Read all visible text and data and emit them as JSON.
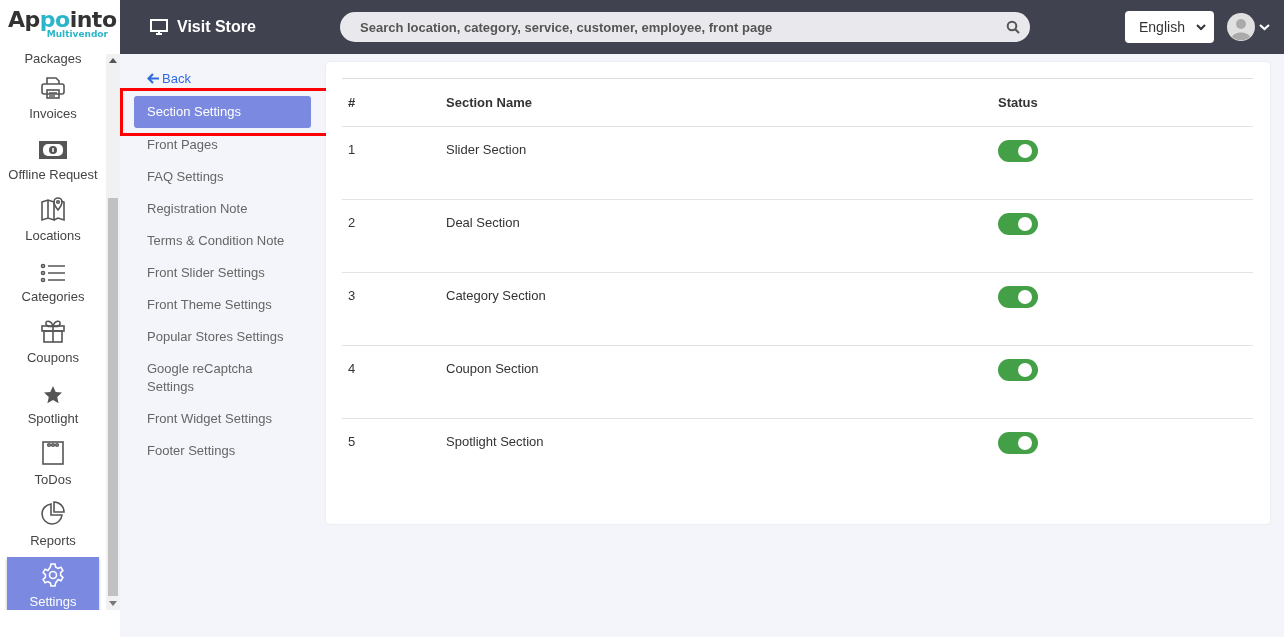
{
  "logo": {
    "parts": [
      {
        "text": "Ap",
        "kind": "plain"
      },
      {
        "text": "po",
        "kind": "accent"
      },
      {
        "text": "into",
        "kind": "plain"
      }
    ],
    "subtitle": "Multivendor"
  },
  "sidebar": {
    "items": [
      {
        "label": "Packages",
        "selected": false
      },
      {
        "label": "Invoices",
        "selected": false
      },
      {
        "label": "Offline Request",
        "selected": false
      },
      {
        "label": "Locations",
        "selected": false
      },
      {
        "label": "Categories",
        "selected": false
      },
      {
        "label": "Coupons",
        "selected": false
      },
      {
        "label": "Spotlight",
        "selected": false
      },
      {
        "label": "ToDos",
        "selected": false
      },
      {
        "label": "Reports",
        "selected": false
      },
      {
        "label": "Settings",
        "selected": true
      }
    ]
  },
  "topbar": {
    "visit_store": "Visit Store",
    "search": {
      "placeholder": "Search location, category, service, customer, employee, front page"
    },
    "language": "English"
  },
  "settings_menu": {
    "back": "Back",
    "items": [
      {
        "label": "Section Settings",
        "selected": true,
        "highlighted": true
      },
      {
        "label": "Front Pages",
        "selected": false,
        "highlighted": false
      },
      {
        "label": "FAQ Settings",
        "selected": false,
        "highlighted": false
      },
      {
        "label": "Registration Note",
        "selected": false,
        "highlighted": false
      },
      {
        "label": "Terms & Condition Note",
        "selected": false,
        "highlighted": false
      },
      {
        "label": "Front Slider Settings",
        "selected": false,
        "highlighted": false
      },
      {
        "label": "Front Theme Settings",
        "selected": false,
        "highlighted": false
      },
      {
        "label": "Popular Stores Settings",
        "selected": false,
        "highlighted": false
      },
      {
        "label": "Google reCaptcha Settings",
        "selected": false,
        "highlighted": false
      },
      {
        "label": "Front Widget Settings",
        "selected": false,
        "highlighted": false
      },
      {
        "label": "Footer Settings",
        "selected": false,
        "highlighted": false
      }
    ]
  },
  "table": {
    "columns": [
      "#",
      "Section Name",
      "Status"
    ],
    "rows": [
      {
        "number": "1",
        "name": "Slider Section",
        "on": true
      },
      {
        "number": "2",
        "name": "Deal Section",
        "on": true
      },
      {
        "number": "3",
        "name": "Category Section",
        "on": true
      },
      {
        "number": "4",
        "name": "Coupon Section",
        "on": true
      },
      {
        "number": "5",
        "name": "Spotlight Section",
        "on": true
      }
    ]
  }
}
